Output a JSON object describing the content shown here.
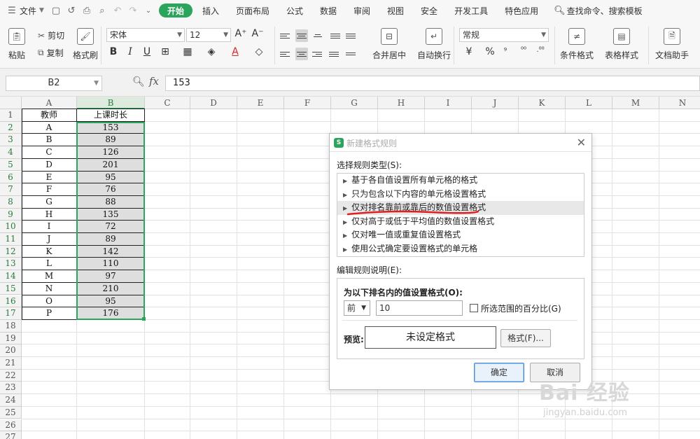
{
  "menubar": {
    "file_label": "文件",
    "tabs": [
      "开始",
      "插入",
      "页面布局",
      "公式",
      "数据",
      "审阅",
      "视图",
      "安全",
      "开发工具",
      "特色应用"
    ],
    "search_label": "查找命令、搜索模板"
  },
  "ribbon": {
    "paste": "粘贴",
    "cut": "剪切",
    "copy": "复制",
    "format_painter": "格式刷",
    "font_name": "宋体",
    "font_size": "12",
    "merge_center": "合并居中",
    "wrap_text": "自动换行",
    "number_format": "常规",
    "percent": "%",
    "conditional_format": "条件格式",
    "table_style": "表格样式",
    "doc_helper": "文档助手",
    "bold": "B",
    "italic": "I",
    "underline": "U",
    "font_color_letter": "A"
  },
  "formula_bar": {
    "name_box": "B2",
    "fx": "fx",
    "value": "153"
  },
  "columns": [
    "A",
    "B",
    "C",
    "D",
    "E",
    "F",
    "G",
    "H",
    "I",
    "J",
    "K",
    "L",
    "M",
    "N"
  ],
  "rows": [
    "1",
    "2",
    "3",
    "4",
    "5",
    "6",
    "7",
    "8",
    "9",
    "10",
    "11",
    "12",
    "13",
    "14",
    "15",
    "16",
    "17",
    "18",
    "19",
    "20",
    "21",
    "22",
    "23",
    "24",
    "25",
    "26",
    "27"
  ],
  "table": {
    "header": [
      "教师",
      "上课时长"
    ],
    "rows": [
      [
        "A",
        "153"
      ],
      [
        "B",
        "89"
      ],
      [
        "C",
        "126"
      ],
      [
        "D",
        "201"
      ],
      [
        "E",
        "95"
      ],
      [
        "F",
        "76"
      ],
      [
        "G",
        "88"
      ],
      [
        "H",
        "135"
      ],
      [
        "I",
        "72"
      ],
      [
        "J",
        "89"
      ],
      [
        "K",
        "142"
      ],
      [
        "L",
        "110"
      ],
      [
        "M",
        "97"
      ],
      [
        "N",
        "210"
      ],
      [
        "O",
        "95"
      ],
      [
        "P",
        "176"
      ]
    ]
  },
  "dialog": {
    "title": "新建格式规则",
    "logo_letter": "S",
    "select_type_label": "选择规则类型(S):",
    "rule_types": [
      "基于各自值设置所有单元格的格式",
      "只为包含以下内容的单元格设置格式",
      "仅对排名靠前或靠后的数值设置格式",
      "仅对高于或低于平均值的数值设置格式",
      "仅对唯一值或重复值设置格式",
      "使用公式确定要设置格式的单元格"
    ],
    "edit_label": "编辑规则说明(E):",
    "rank_title": "为以下排名内的值设置格式(O):",
    "rank_direction": "前",
    "rank_value": "10",
    "percent_label": "所选范围的百分比(G)",
    "preview_label": "预览:",
    "preview_text": "未设定格式",
    "format_button": "格式(F)...",
    "ok": "确定",
    "cancel": "取消"
  },
  "watermark": {
    "logo": "Bai 经验",
    "url": "jingyan.baidu.com"
  },
  "colors": {
    "accent_green": "#2aa55b",
    "selection_fill": "#dedede",
    "annotation_red": "#e02020"
  }
}
